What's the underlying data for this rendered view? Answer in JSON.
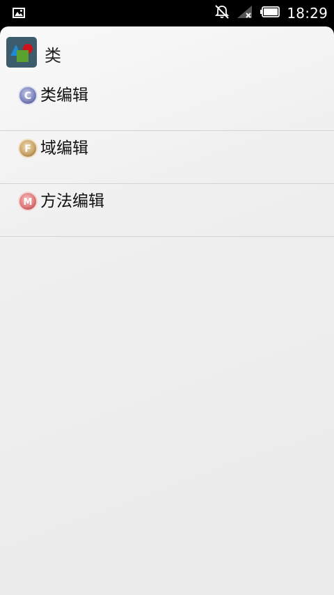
{
  "status_bar": {
    "time": "18:29",
    "icons": [
      "image-notification-icon",
      "bell-muted-icon",
      "signal-no-service-icon",
      "battery-full-icon"
    ]
  },
  "app": {
    "title": "类",
    "icon": "shapes-app-icon"
  },
  "list": {
    "items": [
      {
        "badge_letter": "C",
        "label": "类编辑",
        "badge_color": "#7f86bd"
      },
      {
        "badge_letter": "F",
        "label": "域编辑",
        "badge_color": "#c9a46a"
      },
      {
        "badge_letter": "M",
        "label": "方法编辑",
        "badge_color": "#e07b7b"
      }
    ]
  }
}
